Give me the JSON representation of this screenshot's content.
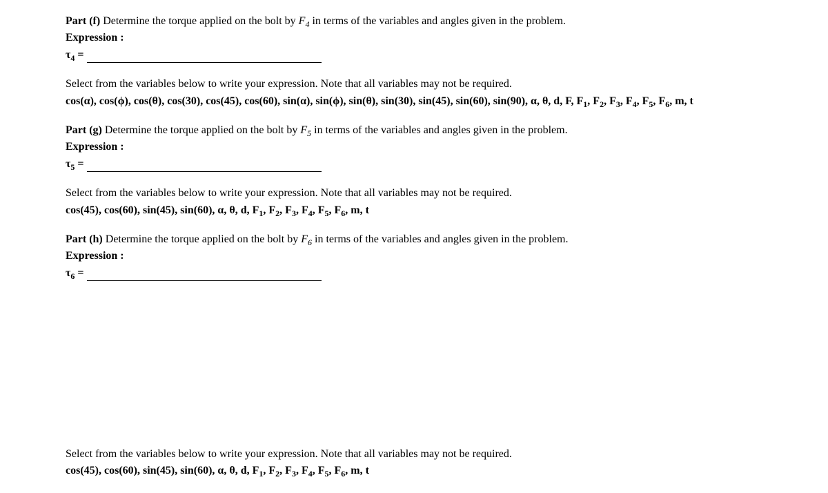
{
  "parts": {
    "f": {
      "label": "Part (f)",
      "question_before": " Determine the torque applied on the bolt by ",
      "force_var": "F",
      "force_sub": "4",
      "question_after": " in terms of the variables and angles given in the problem.",
      "expr_label": "Expression   :",
      "tau_letter": "τ",
      "tau_sub": "4",
      "tau_equals": " ="
    },
    "g": {
      "label": "Part (g)",
      "question_before": " Determine the torque applied on the bolt by ",
      "force_var": "F",
      "force_sub": "5",
      "question_after": " in terms of the variables and angles given in the problem.",
      "expr_label": "Expression   :",
      "tau_letter": "τ",
      "tau_sub": "5",
      "tau_equals": " ="
    },
    "h": {
      "label": "Part (h)",
      "question_before": " Determine the torque applied on the bolt by ",
      "force_var": "F",
      "force_sub": "6",
      "question_after": " in terms of the variables and angles given in the problem.",
      "expr_label": "Expression   :",
      "tau_letter": "τ",
      "tau_sub": "6",
      "tau_equals": " ="
    }
  },
  "select": {
    "note": "Select from the variables below to write your expression. Note that all variables may not be required.",
    "vars_f_prefix": "cos(α), cos(ϕ), cos(θ), cos(30), cos(45), cos(60), sin(α), sin(ϕ), sin(θ), sin(30), sin(45), sin(60), sin(90), α, θ, d, F, F",
    "vars_g_prefix": "cos(45), cos(60), sin(45), sin(60), α, θ, d, F",
    "vars_h_prefix": "cos(45), cos(60), sin(45), sin(60), α, θ, d, F",
    "f_suffix": ", m, t",
    "comma_F": ", F",
    "s1": "1",
    "s2": "2",
    "s3": "3",
    "s4": "4",
    "s5": "5",
    "s6": "6"
  }
}
